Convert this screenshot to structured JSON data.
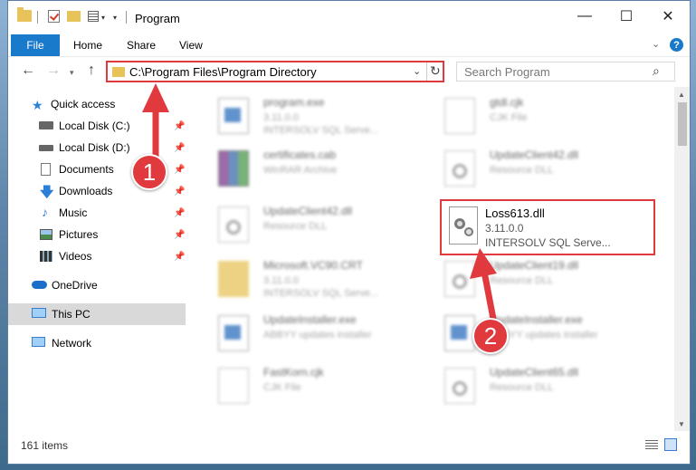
{
  "window": {
    "title": "Program"
  },
  "ribbon": {
    "file": "File",
    "tabs": [
      "Home",
      "Share",
      "View"
    ]
  },
  "address": {
    "path": "C:\\Program Files\\Program Directory"
  },
  "search": {
    "placeholder": "Search Program"
  },
  "nav": {
    "items": [
      {
        "label": "Quick access",
        "icon": "star-icon"
      },
      {
        "label": "Local Disk (C:)",
        "icon": "drive-icon"
      },
      {
        "label": "Local Disk (D:)",
        "icon": "drive-icon"
      },
      {
        "label": "Documents",
        "icon": "documents-icon"
      },
      {
        "label": "Downloads",
        "icon": "download-icon"
      },
      {
        "label": "Music",
        "icon": "music-icon"
      },
      {
        "label": "Pictures",
        "icon": "pictures-icon"
      },
      {
        "label": "Videos",
        "icon": "videos-icon"
      },
      {
        "label": "OneDrive",
        "icon": "cloud-icon"
      },
      {
        "label": "This PC",
        "icon": "computer-icon"
      },
      {
        "label": "Network",
        "icon": "network-icon"
      }
    ]
  },
  "files": [
    {
      "name": "program.exe",
      "line2": "3.11.0.0",
      "line3": "INTERSOLV SQL Serve...",
      "icon": "exe-icon"
    },
    {
      "name": "gtdl.cjk",
      "line2": "CJK File",
      "line3": "",
      "icon": "doc-icon"
    },
    {
      "name": "certificates.cab",
      "line2": "WinRAR Archive",
      "line3": "",
      "icon": "archive-icon"
    },
    {
      "name": "UpdateClient42.dll",
      "line2": "Resource DLL",
      "line3": "",
      "icon": "dll-icon"
    },
    {
      "name": "UpdateClient42.dll",
      "line2": "Resource DLL",
      "line3": "",
      "icon": "dll-icon"
    },
    {
      "name": "Microsoft.VC90.CRT",
      "line2": "3.11.0.0",
      "line3": "INTERSOLV SQL Serve...",
      "icon": "folder-icon"
    },
    {
      "name": "UpdateClient19.dll",
      "line2": "Resource DLL",
      "line3": "",
      "icon": "dll-icon"
    },
    {
      "name": "UpdateInstaller.exe",
      "line2": "ABBYY updates installer",
      "line3": "",
      "icon": "exe-icon"
    },
    {
      "name": "UpdateInstaller.exe",
      "line2": "ABBYY updates installer",
      "line3": "",
      "icon": "exe-icon"
    },
    {
      "name": "FastKorn.cjk",
      "line2": "CJK File",
      "line3": "",
      "icon": "doc-icon"
    },
    {
      "name": "UpdateClient65.dll",
      "line2": "Resource DLL",
      "line3": "",
      "icon": "dll-icon"
    }
  ],
  "highlight": {
    "name": "Loss613.dll",
    "line2": "3.11.0.0",
    "line3": "INTERSOLV SQL Serve..."
  },
  "badges": {
    "one": "1",
    "two": "2"
  },
  "status": {
    "count": "161 items"
  },
  "colors": {
    "accent": "#1979ca",
    "highlight": "#e0393e"
  }
}
